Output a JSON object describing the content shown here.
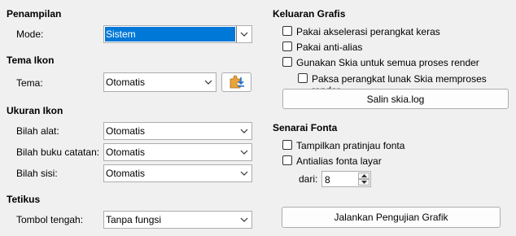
{
  "left": {
    "penampilan": {
      "heading": "Penampilan",
      "mode_label": "Mode:",
      "mode_value": "Sistem"
    },
    "tema_ikon": {
      "heading": "Tema Ikon",
      "tema_label": "Tema:",
      "tema_value": "Otomatis"
    },
    "ukuran_ikon": {
      "heading": "Ukuran Ikon",
      "toolbar_label": "Bilah alat:",
      "toolbar_value": "Otomatis",
      "notebookbar_label": "Bilah buku catatan:",
      "notebookbar_value": "Otomatis",
      "sidebar_label": "Bilah sisi:",
      "sidebar_value": "Otomatis"
    },
    "tetikus": {
      "heading": "Tetikus",
      "middle_label": "Tombol tengah:",
      "middle_value": "Tanpa fungsi"
    }
  },
  "right": {
    "keluaran": {
      "heading": "Keluaran Grafis",
      "hw_accel": "Pakai akselerasi perangkat keras",
      "antialias": "Pakai anti-alias",
      "skia_all": "Gunakan Skia untuk semua proses render",
      "skia_sw": "Paksa perangkat lunak Skia memproses render",
      "copy_log": "Salin skia.log"
    },
    "fonta": {
      "heading": "Senarai Fonta",
      "preview": "Tampilkan pratinjau fonta",
      "screen_aa": "Antialias fonta layar",
      "from_label": "dari:",
      "from_value": "8"
    },
    "run_test": "Jalankan Pengujian Grafik"
  }
}
